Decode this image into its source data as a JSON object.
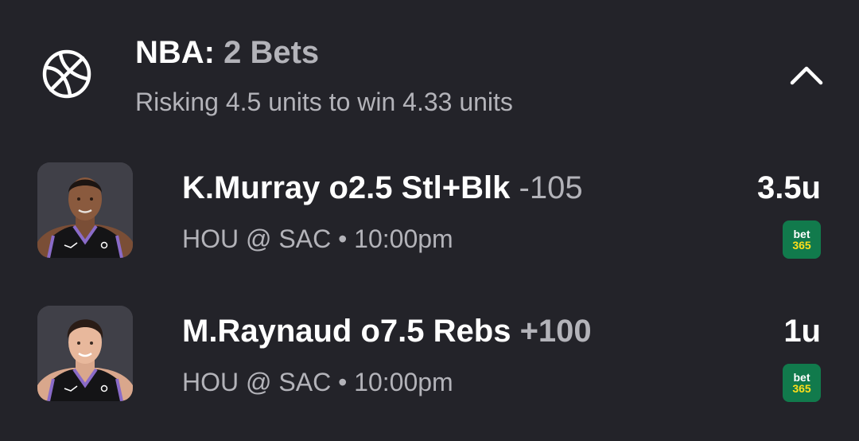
{
  "header": {
    "league": "NBA:",
    "bet_count": "2 Bets",
    "summary": "Risking 4.5 units to win 4.33 units",
    "icon": "basketball-icon",
    "toggle_icon": "chevron-up-icon"
  },
  "bets": [
    {
      "pick": "K.Murray o2.5 Stl+Blk",
      "odds": "-105",
      "game": "HOU @ SAC • 10:00pm",
      "stake": "3.5u",
      "book": {
        "line1": "bet",
        "line2": "365"
      }
    },
    {
      "pick": "M.Raynaud o7.5 Rebs",
      "odds": "+100",
      "game": "HOU @ SAC • 10:00pm",
      "stake": "1u",
      "book": {
        "line1": "bet",
        "line2": "365"
      }
    }
  ],
  "colors": {
    "background": "#232329",
    "muted_text": "#b3b3b9",
    "book_green": "#117a4c",
    "book_yellow": "#ffdf1b",
    "jersey_black": "#141416",
    "jersey_purple": "#8a6bc8"
  }
}
